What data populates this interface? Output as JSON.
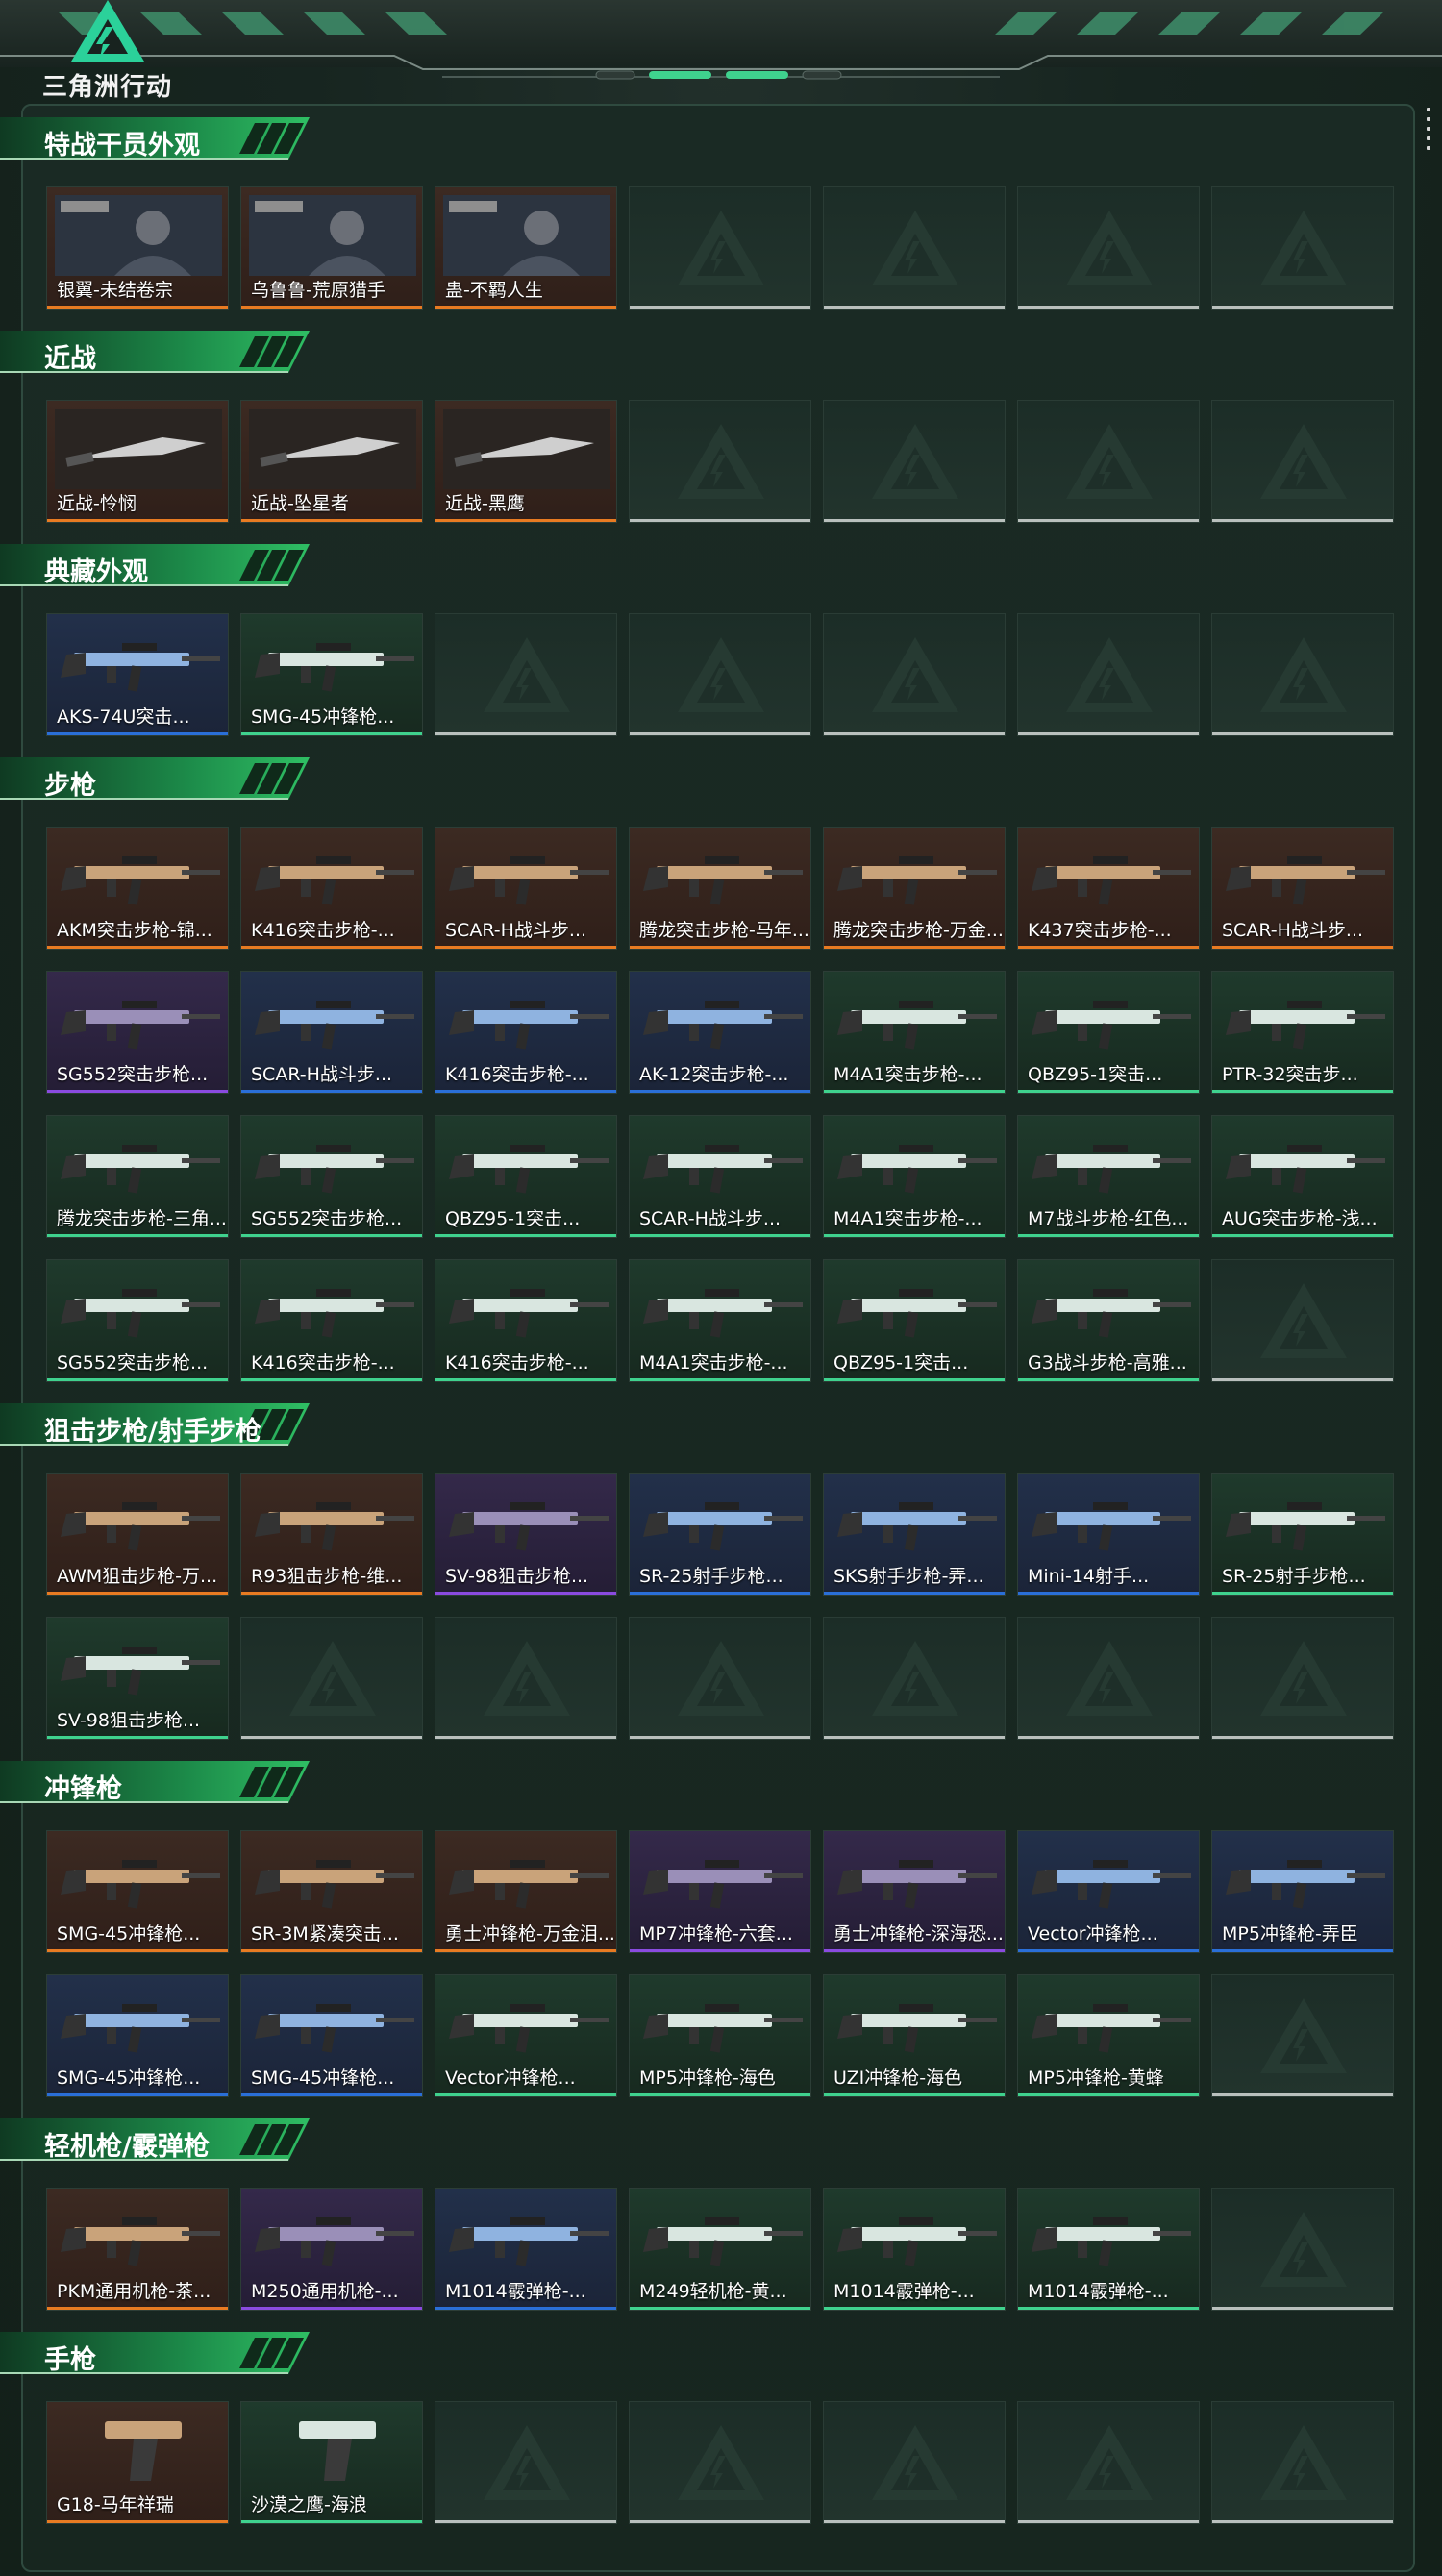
{
  "header": {
    "logo_text": "三角洲行动",
    "icon": "triangle-logo-icon"
  },
  "colors": {
    "orange": "#e87b22",
    "purple": "#8a4be0",
    "blue": "#2a6fd8",
    "green": "#3fd28e",
    "empty": "#b9c0bd",
    "accent_green": "#1f8a4f"
  },
  "categories": [
    {
      "title": "特战干员外观",
      "rows": [
        [
          {
            "name": "银翼-未结卷宗",
            "rarity": "orange",
            "icon": "operator-skin"
          },
          {
            "name": "乌鲁鲁-荒原猎手",
            "rarity": "orange",
            "icon": "operator-skin"
          },
          {
            "name": "蛊-不羁人生",
            "rarity": "orange",
            "icon": "operator-skin"
          },
          null,
          null,
          null,
          null
        ]
      ]
    },
    {
      "title": "近战",
      "rows": [
        [
          {
            "name": "近战-怜悯",
            "rarity": "orange",
            "icon": "knife"
          },
          {
            "name": "近战-坠星者",
            "rarity": "orange",
            "icon": "knife"
          },
          {
            "name": "近战-黑鹰",
            "rarity": "orange",
            "icon": "knife"
          },
          null,
          null,
          null,
          null
        ]
      ]
    },
    {
      "title": "典藏外观",
      "rows": [
        [
          {
            "name": "AKS-74U突击...",
            "rarity": "blue",
            "icon": "gun"
          },
          {
            "name": "SMG-45冲锋枪...",
            "rarity": "green",
            "icon": "gun"
          },
          null,
          null,
          null,
          null,
          null
        ]
      ]
    },
    {
      "title": "步枪",
      "rows": [
        [
          {
            "name": "AKM突击步枪-锦...",
            "rarity": "orange",
            "icon": "gun"
          },
          {
            "name": "K416突击步枪-...",
            "rarity": "orange",
            "icon": "gun"
          },
          {
            "name": "SCAR-H战斗步...",
            "rarity": "orange",
            "icon": "gun"
          },
          {
            "name": "腾龙突击步枪-马年...",
            "rarity": "orange",
            "icon": "gun"
          },
          {
            "name": "腾龙突击步枪-万金...",
            "rarity": "orange",
            "icon": "gun"
          },
          {
            "name": "K437突击步枪-...",
            "rarity": "orange",
            "icon": "gun"
          },
          {
            "name": "SCAR-H战斗步...",
            "rarity": "orange",
            "icon": "gun"
          }
        ],
        [
          {
            "name": "SG552突击步枪...",
            "rarity": "purple",
            "icon": "gun"
          },
          {
            "name": "SCAR-H战斗步...",
            "rarity": "blue",
            "icon": "gun"
          },
          {
            "name": "K416突击步枪-...",
            "rarity": "blue",
            "icon": "gun"
          },
          {
            "name": "AK-12突击步枪-...",
            "rarity": "blue",
            "icon": "gun"
          },
          {
            "name": "M4A1突击步枪-...",
            "rarity": "green",
            "icon": "gun"
          },
          {
            "name": "QBZ95-1突击...",
            "rarity": "green",
            "icon": "gun"
          },
          {
            "name": "PTR-32突击步...",
            "rarity": "green",
            "icon": "gun"
          }
        ],
        [
          {
            "name": "腾龙突击步枪-三角...",
            "rarity": "green",
            "icon": "gun"
          },
          {
            "name": "SG552突击步枪...",
            "rarity": "green",
            "icon": "gun"
          },
          {
            "name": "QBZ95-1突击...",
            "rarity": "green",
            "icon": "gun"
          },
          {
            "name": "SCAR-H战斗步...",
            "rarity": "green",
            "icon": "gun"
          },
          {
            "name": "M4A1突击步枪-...",
            "rarity": "green",
            "icon": "gun"
          },
          {
            "name": "M7战斗步枪-红色...",
            "rarity": "green",
            "icon": "gun"
          },
          {
            "name": "AUG突击步枪-浅...",
            "rarity": "green",
            "icon": "gun"
          }
        ],
        [
          {
            "name": "SG552突击步枪...",
            "rarity": "green",
            "icon": "gun"
          },
          {
            "name": "K416突击步枪-...",
            "rarity": "green",
            "icon": "gun"
          },
          {
            "name": "K416突击步枪-...",
            "rarity": "green",
            "icon": "gun"
          },
          {
            "name": "M4A1突击步枪-...",
            "rarity": "green",
            "icon": "gun"
          },
          {
            "name": "QBZ95-1突击...",
            "rarity": "green",
            "icon": "gun"
          },
          {
            "name": "G3战斗步枪-高雅...",
            "rarity": "green",
            "icon": "gun"
          },
          null
        ]
      ]
    },
    {
      "title": "狙击步枪/射手步枪",
      "rows": [
        [
          {
            "name": "AWM狙击步枪-万...",
            "rarity": "orange",
            "icon": "gun"
          },
          {
            "name": "R93狙击步枪-维...",
            "rarity": "orange",
            "icon": "gun"
          },
          {
            "name": "SV-98狙击步枪...",
            "rarity": "purple",
            "icon": "gun"
          },
          {
            "name": "SR-25射手步枪...",
            "rarity": "blue",
            "icon": "gun"
          },
          {
            "name": "SKS射手步枪-弄...",
            "rarity": "blue",
            "icon": "gun"
          },
          {
            "name": "Mini-14射手...",
            "rarity": "blue",
            "icon": "gun"
          },
          {
            "name": "SR-25射手步枪...",
            "rarity": "green",
            "icon": "gun"
          }
        ],
        [
          {
            "name": "SV-98狙击步枪...",
            "rarity": "green",
            "icon": "gun"
          },
          null,
          null,
          null,
          null,
          null,
          null
        ]
      ]
    },
    {
      "title": "冲锋枪",
      "rows": [
        [
          {
            "name": "SMG-45冲锋枪...",
            "rarity": "orange",
            "icon": "gun"
          },
          {
            "name": "SR-3M紧凑突击...",
            "rarity": "orange",
            "icon": "gun"
          },
          {
            "name": "勇士冲锋枪-万金泪...",
            "rarity": "orange",
            "icon": "gun"
          },
          {
            "name": "MP7冲锋枪-六套...",
            "rarity": "purple",
            "icon": "gun"
          },
          {
            "name": "勇士冲锋枪-深海恐...",
            "rarity": "purple",
            "icon": "gun"
          },
          {
            "name": "Vector冲锋枪...",
            "rarity": "blue",
            "icon": "gun"
          },
          {
            "name": "MP5冲锋枪-弄臣",
            "rarity": "blue",
            "icon": "gun"
          }
        ],
        [
          {
            "name": "SMG-45冲锋枪...",
            "rarity": "blue",
            "icon": "gun"
          },
          {
            "name": "SMG-45冲锋枪...",
            "rarity": "blue",
            "icon": "gun"
          },
          {
            "name": "Vector冲锋枪...",
            "rarity": "green",
            "icon": "gun"
          },
          {
            "name": "MP5冲锋枪-海色",
            "rarity": "green",
            "icon": "gun"
          },
          {
            "name": "UZI冲锋枪-海色",
            "rarity": "green",
            "icon": "gun"
          },
          {
            "name": "MP5冲锋枪-黄蜂",
            "rarity": "green",
            "icon": "gun"
          },
          null
        ]
      ]
    },
    {
      "title": "轻机枪/霰弹枪",
      "rows": [
        [
          {
            "name": "PKM通用机枪-茶...",
            "rarity": "orange",
            "icon": "gun"
          },
          {
            "name": "M250通用机枪-...",
            "rarity": "purple",
            "icon": "gun"
          },
          {
            "name": "M1014霰弹枪-...",
            "rarity": "blue",
            "icon": "gun"
          },
          {
            "name": "M249轻机枪-黄...",
            "rarity": "green",
            "icon": "gun"
          },
          {
            "name": "M1014霰弹枪-...",
            "rarity": "green",
            "icon": "gun"
          },
          {
            "name": "M1014霰弹枪-...",
            "rarity": "green",
            "icon": "gun"
          },
          null
        ]
      ]
    },
    {
      "title": "手枪",
      "rows": [
        [
          {
            "name": "G18-马年祥瑞",
            "rarity": "orange",
            "icon": "pistol"
          },
          {
            "name": "沙漠之鹰-海浪",
            "rarity": "green",
            "icon": "pistol"
          },
          null,
          null,
          null,
          null,
          null
        ]
      ]
    }
  ]
}
